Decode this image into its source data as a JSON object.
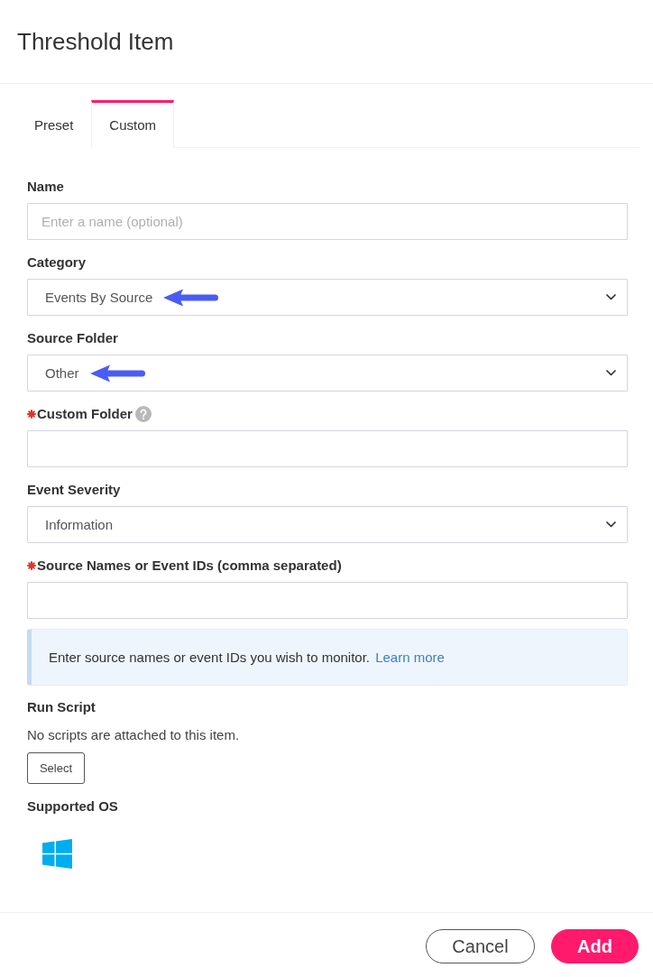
{
  "dialog": {
    "title": "Threshold Item"
  },
  "tabs": [
    {
      "label": "Preset",
      "selected": false
    },
    {
      "label": "Custom",
      "selected": true
    }
  ],
  "fields": [
    {
      "kind": "text",
      "label": "Name",
      "required": false,
      "help": false,
      "arrow": false,
      "placeholder": "Enter a name (optional)"
    },
    {
      "kind": "select",
      "label": "Category",
      "required": false,
      "help": false,
      "arrow": true,
      "value": "Events By Source"
    },
    {
      "kind": "select",
      "label": "Source Folder",
      "required": false,
      "help": false,
      "arrow": true,
      "value": "Other"
    },
    {
      "kind": "text",
      "label": "Custom Folder",
      "required": true,
      "help": true,
      "arrow": false
    },
    {
      "kind": "select",
      "label": "Event Severity",
      "required": false,
      "help": false,
      "arrow": false,
      "value": "Information"
    },
    {
      "kind": "text",
      "label": "Source Names or Event IDs (comma separated)",
      "required": true,
      "help": false,
      "arrow": false
    }
  ],
  "info": {
    "text": "Enter source names or event IDs you wish to monitor.",
    "link": "Learn more"
  },
  "run_script": {
    "label": "Run Script",
    "text": "No scripts are attached to this item.",
    "button": "Select"
  },
  "supported_os": {
    "label": "Supported OS",
    "systems": [
      {
        "kind": "windows"
      }
    ]
  },
  "buttons": [
    {
      "label": "Cancel",
      "kind": "secondary"
    },
    {
      "label": "Add",
      "kind": "primary"
    }
  ]
}
